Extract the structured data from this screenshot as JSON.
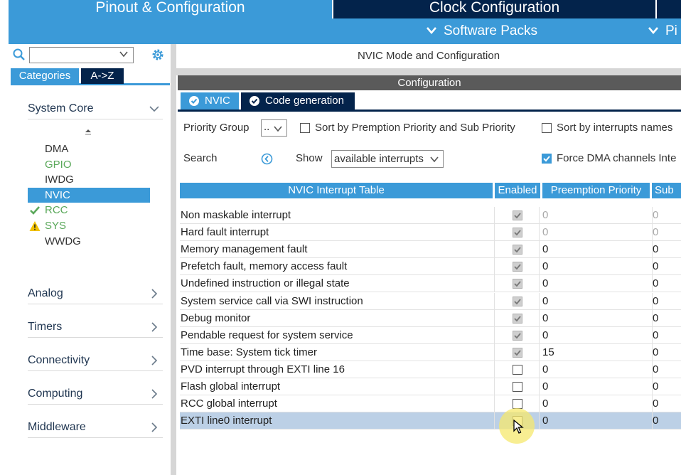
{
  "header": {
    "tabs": [
      {
        "label": "Pinout & Configuration"
      },
      {
        "label": "Clock Configuration"
      }
    ],
    "subtabs": [
      {
        "label": "Software Packs"
      },
      {
        "label": "Pi"
      }
    ]
  },
  "sidebar": {
    "search": {
      "value": ""
    },
    "tabs": [
      {
        "label": "Categories"
      },
      {
        "label": "A->Z"
      }
    ],
    "system_core": {
      "label": "System Core",
      "items": [
        {
          "label": "DMA",
          "color": "#333333",
          "status": "none"
        },
        {
          "label": "GPIO",
          "color": "#5aa85a",
          "status": "none"
        },
        {
          "label": "IWDG",
          "color": "#333333",
          "status": "none"
        },
        {
          "label": "NVIC",
          "color": "#ffffff",
          "status": "selected"
        },
        {
          "label": "RCC",
          "color": "#5aa85a",
          "status": "check"
        },
        {
          "label": "SYS",
          "color": "#5aa85a",
          "status": "warning"
        },
        {
          "label": "WWDG",
          "color": "#333333",
          "status": "none"
        }
      ]
    },
    "categories": [
      {
        "label": "Analog"
      },
      {
        "label": "Timers"
      },
      {
        "label": "Connectivity"
      },
      {
        "label": "Computing"
      },
      {
        "label": "Middleware"
      }
    ]
  },
  "main": {
    "mode_title": "NVIC Mode and Configuration",
    "config_label": "Configuration",
    "tabs": [
      {
        "label": "NVIC"
      },
      {
        "label": "Code generation"
      }
    ],
    "priority_group_label": "Priority Group",
    "priority_group_value": "..",
    "sort_premption_label": "Sort by Premption Priority and Sub Priority",
    "sort_premption_checked": false,
    "sort_names_label": "Sort by interrupts names",
    "sort_names_checked": false,
    "search_label": "Search",
    "show_label": "Show",
    "show_value": "available interrupts",
    "force_dma_label": "Force DMA channels Inte",
    "force_dma_checked": true
  },
  "table": {
    "headers": [
      "NVIC Interrupt Table",
      "Enabled",
      "Preemption Priority",
      "Sub"
    ],
    "rows": [
      {
        "name": "Non maskable interrupt",
        "enabled": true,
        "preemption": "0",
        "sub": "0",
        "dim": true
      },
      {
        "name": "Hard fault interrupt",
        "enabled": true,
        "preemption": "0",
        "sub": "0",
        "dim": true
      },
      {
        "name": "Memory management fault",
        "enabled": true,
        "preemption": "0",
        "sub": "0",
        "dim": false
      },
      {
        "name": "Prefetch fault, memory access fault",
        "enabled": true,
        "preemption": "0",
        "sub": "0",
        "dim": false
      },
      {
        "name": "Undefined instruction or illegal state",
        "enabled": true,
        "preemption": "0",
        "sub": "0",
        "dim": false
      },
      {
        "name": "System service call via SWI instruction",
        "enabled": true,
        "preemption": "0",
        "sub": "0",
        "dim": false
      },
      {
        "name": "Debug monitor",
        "enabled": true,
        "preemption": "0",
        "sub": "0",
        "dim": false
      },
      {
        "name": "Pendable request for system service",
        "enabled": true,
        "preemption": "0",
        "sub": "0",
        "dim": false
      },
      {
        "name": "Time base: System tick timer",
        "enabled": true,
        "preemption": "15",
        "sub": "0",
        "dim": false
      },
      {
        "name": "PVD interrupt through EXTI line 16",
        "enabled": false,
        "preemption": "0",
        "sub": "0",
        "dim": false
      },
      {
        "name": "Flash global interrupt",
        "enabled": false,
        "preemption": "0",
        "sub": "0",
        "dim": false
      },
      {
        "name": "RCC global interrupt",
        "enabled": false,
        "preemption": "0",
        "sub": "0",
        "dim": false
      },
      {
        "name": "EXTI line0 interrupt",
        "enabled": false,
        "preemption": "0",
        "sub": "0",
        "dim": false,
        "selected": true
      }
    ]
  },
  "colors": {
    "accent": "#3b9ad8",
    "dark_tab": "#03234b",
    "ok_green": "#5aa85a",
    "warn_yellow": "#f2c200",
    "row_selected": "#bcd0e6"
  }
}
